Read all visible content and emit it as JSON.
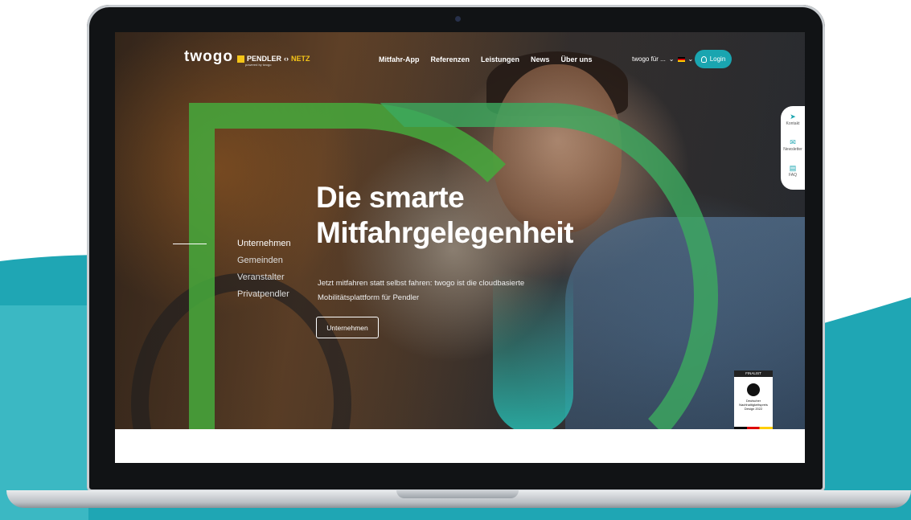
{
  "colors": {
    "teal_accent": "#1aa5b0",
    "green_frame": "#46aa3c",
    "pendler_yellow": "#f5c518"
  },
  "nav": {
    "logo": "twogo",
    "pendler_main": "PENDLER",
    "pendler_netz": "NETZ",
    "pendler_sub": "powered by twogo",
    "menu": [
      "Mitfahr-App",
      "Referenzen",
      "Leistungen",
      "News",
      "Über uns"
    ],
    "lang_select": "twogo für ...",
    "login": "Login"
  },
  "side_nav": {
    "items": [
      "Unternehmen",
      "Gemeinden",
      "Veranstalter",
      "Privatpendler"
    ]
  },
  "hero": {
    "headline_line1": "Die smarte",
    "headline_line2": "Mitfahrgelegenheit",
    "subtext_line1": "Jetzt mitfahren statt selbst fahren: twogo ist die cloudbasierte",
    "subtext_line2": "Mobilitätsplattform für Pendler",
    "cta": "Unternehmen"
  },
  "float_bar": {
    "items": [
      {
        "label": "Kontakt",
        "icon": "send-icon"
      },
      {
        "label": "Newsletter",
        "icon": "mail-icon"
      },
      {
        "label": "FAQ",
        "icon": "chat-icon"
      }
    ]
  },
  "badge": {
    "top": "FINALIST",
    "line1": "Deutscher",
    "line2": "Nachhaltigkeitspreis",
    "line3": "Design 2022"
  }
}
